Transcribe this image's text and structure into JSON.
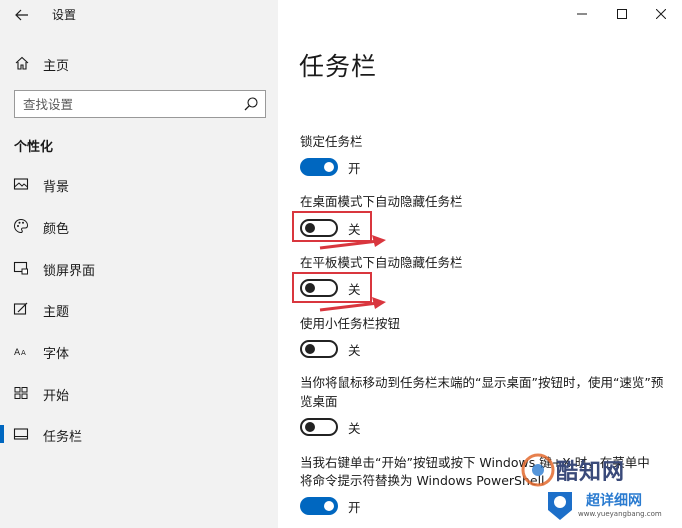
{
  "window": {
    "title": "设置"
  },
  "sidebar": {
    "home_label": "主页",
    "search_placeholder": "查找设置",
    "section_title": "个性化",
    "items": [
      {
        "label": "背景",
        "icon": "picture-icon"
      },
      {
        "label": "颜色",
        "icon": "palette-icon"
      },
      {
        "label": "锁屏界面",
        "icon": "lock-screen-icon"
      },
      {
        "label": "主题",
        "icon": "theme-brush-icon"
      },
      {
        "label": "字体",
        "icon": "font-icon"
      },
      {
        "label": "开始",
        "icon": "start-menu-icon"
      },
      {
        "label": "任务栏",
        "icon": "taskbar-icon",
        "active": true
      }
    ]
  },
  "main": {
    "title": "任务栏",
    "settings": [
      {
        "label": "锁定任务栏",
        "state": "开",
        "on": true
      },
      {
        "label": "在桌面模式下自动隐藏任务栏",
        "state": "关",
        "on": false
      },
      {
        "label": "在平板模式下自动隐藏任务栏",
        "state": "关",
        "on": false
      },
      {
        "label": "使用小任务栏按钮",
        "state": "关",
        "on": false
      },
      {
        "label": "当你将鼠标移动到任务栏末端的“显示桌面”按钮时，使用“速览”预览桌面",
        "state": "关",
        "on": false
      },
      {
        "label_line1": "当我右键单击“开始”按钮或按下 Windows 键+X 时，在菜单中",
        "label_line2": "将命令提示符替换为 Windows PowerShell",
        "state": "开",
        "on": true
      }
    ]
  },
  "watermark": {
    "brand": "酷知网",
    "brand2": "超详细网",
    "url": "www.yueyangbang.com"
  },
  "colors": {
    "accent": "#0067c0",
    "highlight": "#d9363e",
    "sidebar_bg": "#f2f2f2"
  }
}
